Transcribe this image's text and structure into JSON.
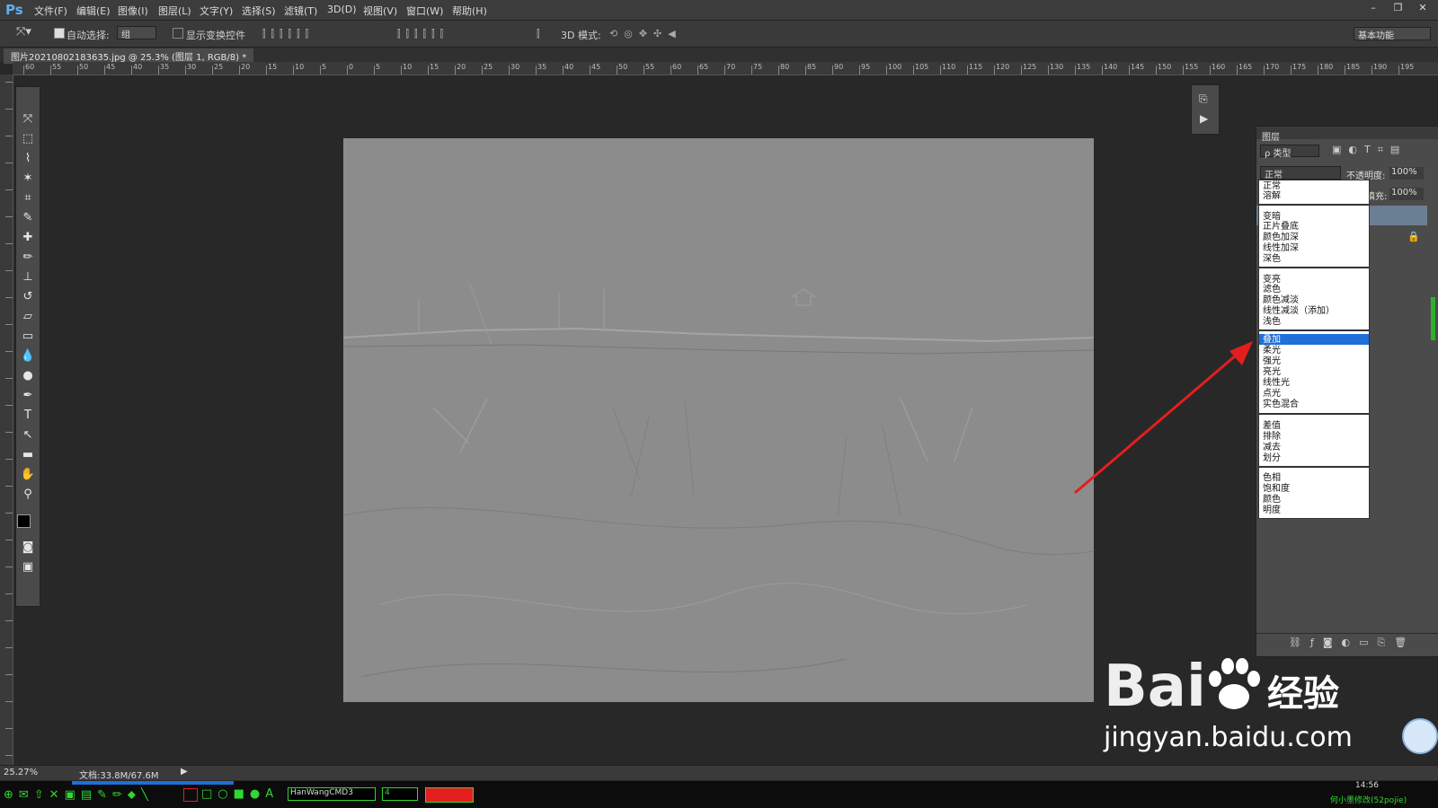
{
  "menubar": {
    "logo": "Ps",
    "items": [
      "文件(F)",
      "编辑(E)",
      "图像(I)",
      "图层(L)",
      "文字(Y)",
      "选择(S)",
      "滤镜(T)",
      "3D(D)",
      "视图(V)",
      "窗口(W)",
      "帮助(H)"
    ]
  },
  "options": {
    "auto_select_label": "自动选择:",
    "auto_select_value": "组",
    "show_transform_label": "显示变换控件",
    "mode_3d_label": "3D 模式:",
    "workspace": "基本功能"
  },
  "document": {
    "tab_title": "图片20210802183635.jpg @ 25.3% (图层 1, RGB/8) *",
    "zoom": "25.27%",
    "doc_size": "文档:33.8M/67.6M"
  },
  "rulers": {
    "h_ticks": [
      "60",
      "55",
      "50",
      "45",
      "40",
      "35",
      "30",
      "25",
      "20",
      "15",
      "10",
      "5",
      "0",
      "5",
      "10",
      "15",
      "20",
      "25",
      "30",
      "35",
      "40",
      "45",
      "50",
      "55",
      "60",
      "65",
      "70",
      "75",
      "80",
      "85",
      "90",
      "95",
      "100",
      "105",
      "110",
      "115",
      "120",
      "125",
      "130",
      "135",
      "140",
      "145",
      "150",
      "155",
      "160",
      "165",
      "170",
      "175",
      "180",
      "185",
      "190",
      "195"
    ]
  },
  "layers_panel": {
    "title": "图层",
    "filter_kind": "ρ 类型",
    "blend_mode": "正常",
    "opacity_label": "不透明度:",
    "opacity_value": "100%",
    "fill_label": "填充:",
    "fill_value": "100%"
  },
  "blend_menu": {
    "groups": [
      [
        "正常",
        "溶解"
      ],
      [
        "变暗",
        "正片叠底",
        "颜色加深",
        "线性加深",
        "深色"
      ],
      [
        "变亮",
        "滤色",
        "颜色减淡",
        "线性减淡（添加）",
        "浅色"
      ],
      [
        "叠加",
        "柔光",
        "强光",
        "亮光",
        "线性光",
        "点光",
        "实色混合"
      ],
      [
        "差值",
        "排除",
        "减去",
        "划分"
      ],
      [
        "色相",
        "饱和度",
        "颜色",
        "明度"
      ]
    ],
    "selected": "叠加"
  },
  "watermark": {
    "brand": "Bai",
    "brand_cn": "经验",
    "url": "jingyan.baidu.com"
  },
  "taskbar": {
    "font_field": "HanWangCMD3",
    "size_field": "4",
    "time": "14:56",
    "credit": "何小墨修改(52pojie)"
  },
  "colors": {
    "accent_blue": "#1e6fd9",
    "arrow_red": "#e41e1e",
    "canvas_gray": "#8e8e8e"
  }
}
